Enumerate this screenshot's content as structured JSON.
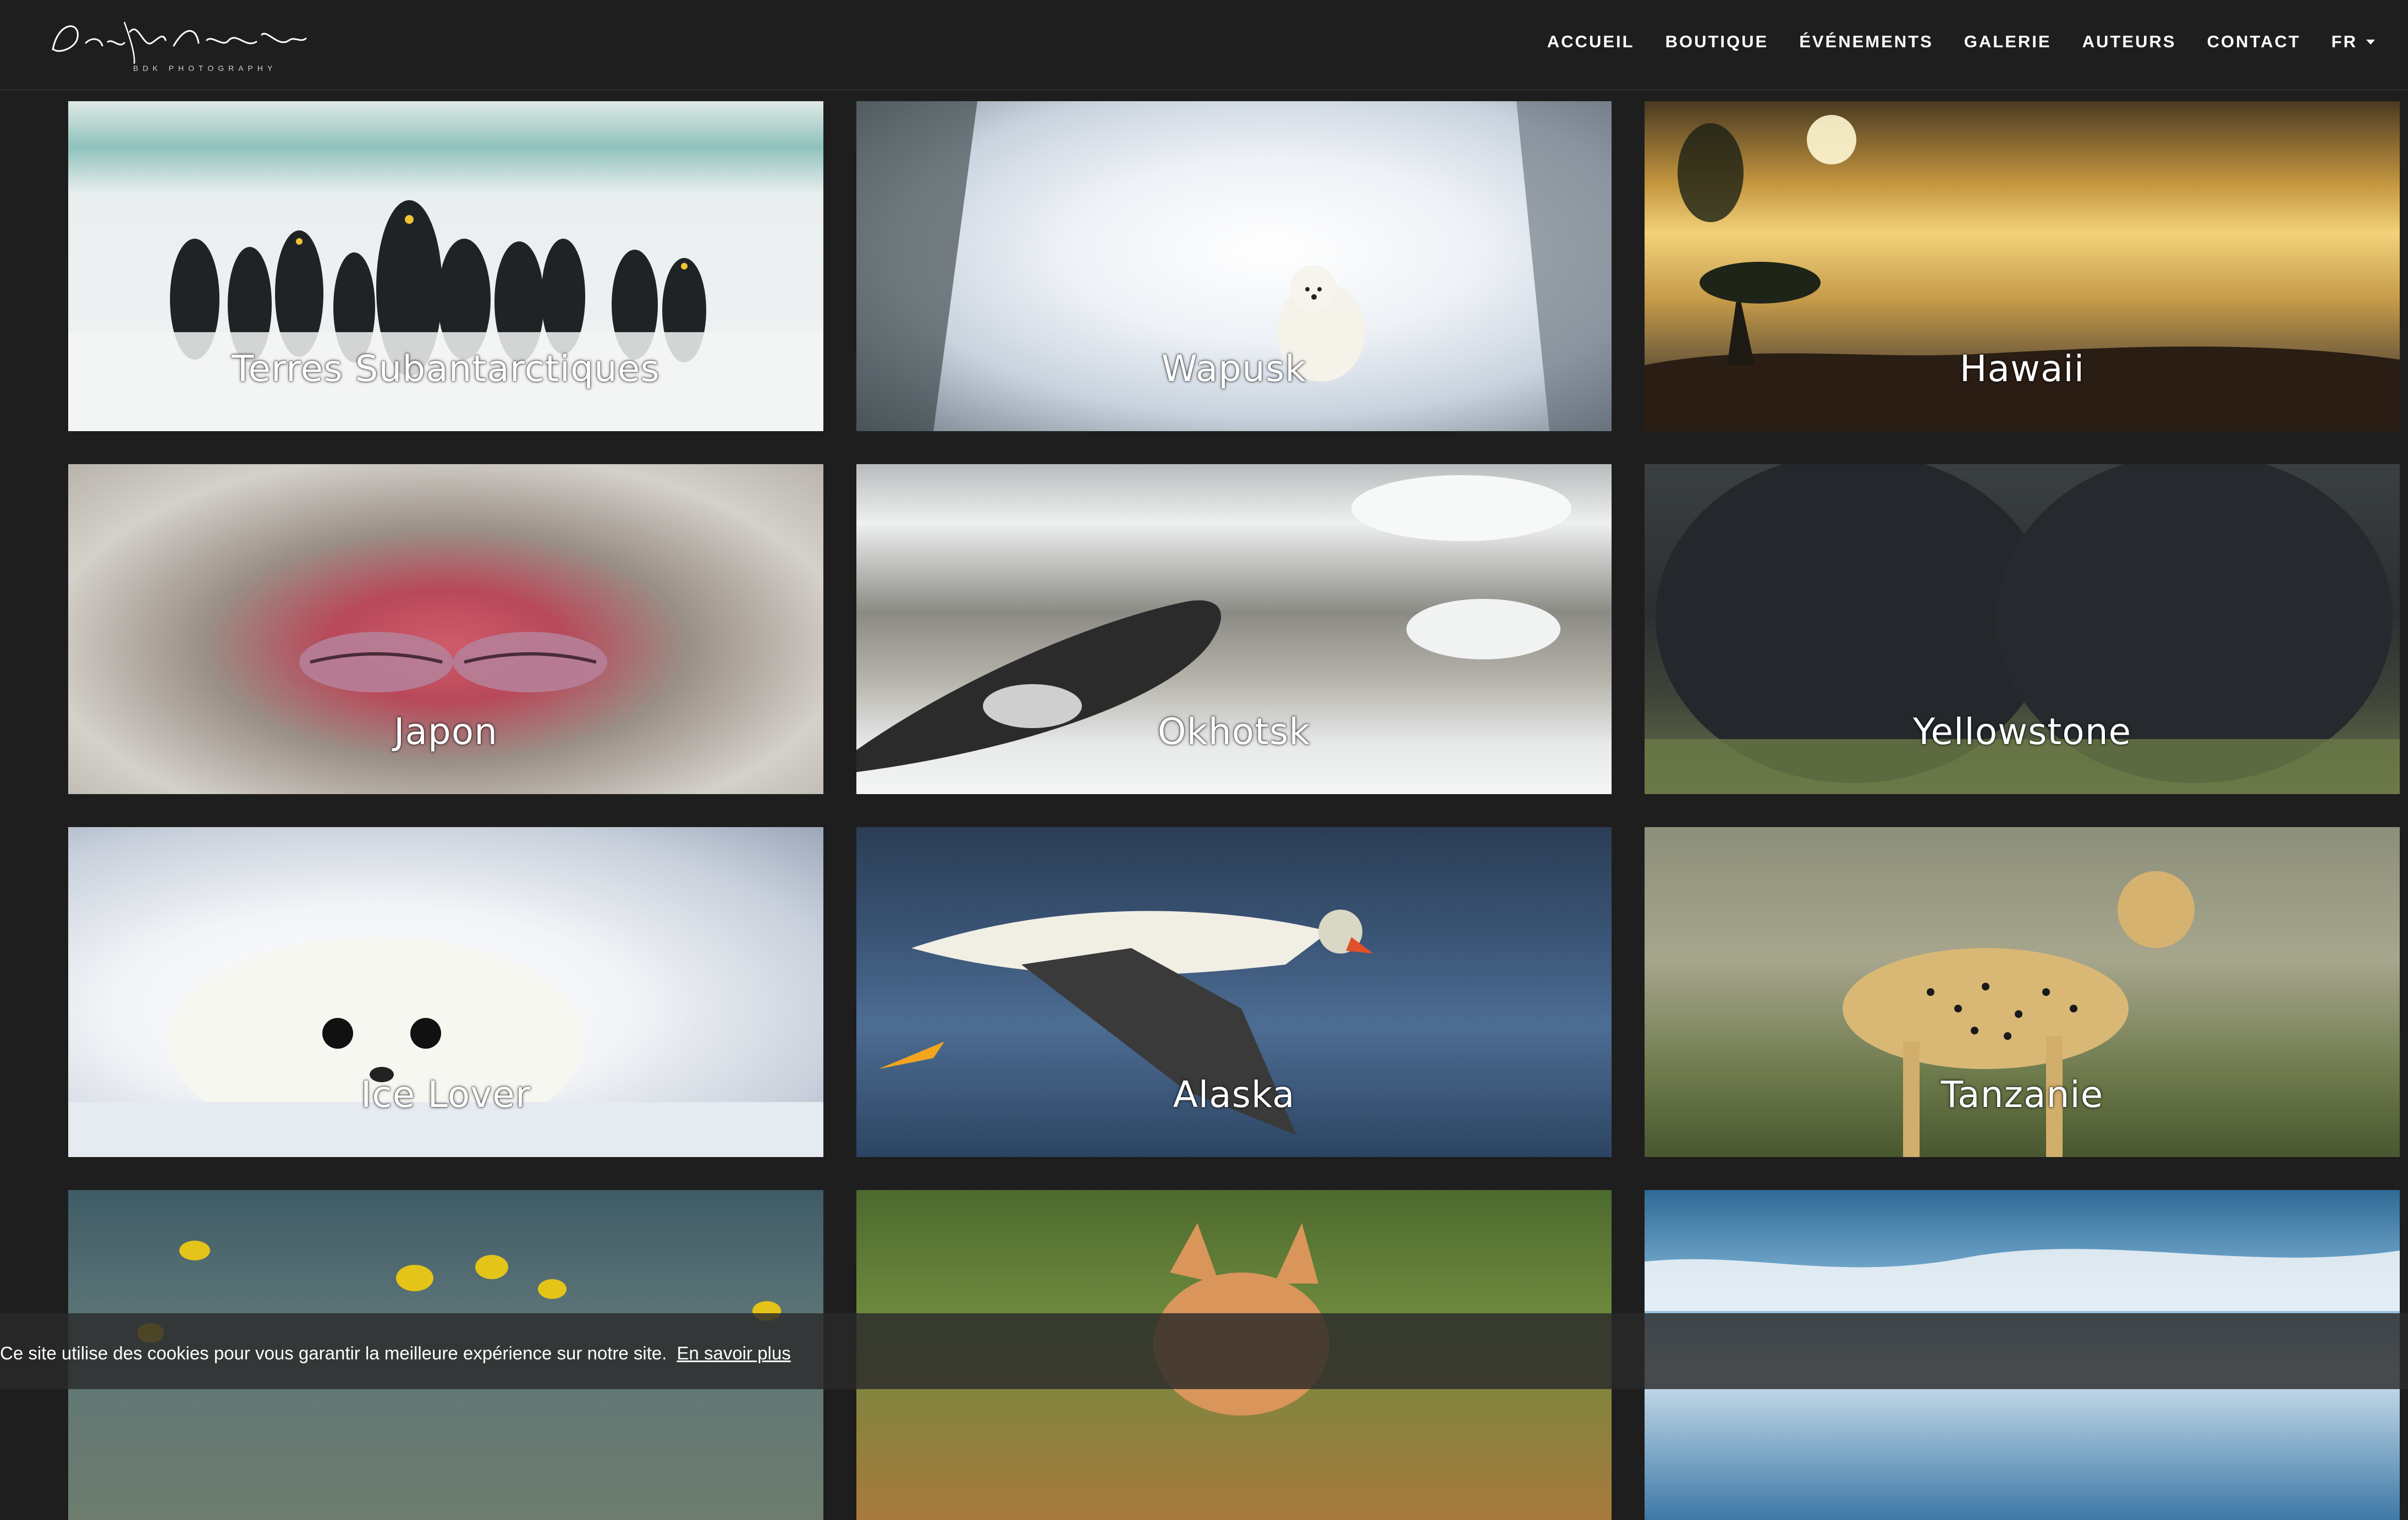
{
  "header": {
    "logo_text": "Dorota & Bruno Sénéchal",
    "logo_subtitle": "BDK PHOTOGRAPHY",
    "nav": [
      {
        "label": "ACCUEIL"
      },
      {
        "label": "BOUTIQUE"
      },
      {
        "label": "ÉVÉNEMENTS"
      },
      {
        "label": "GALERIE"
      },
      {
        "label": "AUTEURS"
      },
      {
        "label": "CONTACT"
      },
      {
        "label": "FR"
      }
    ]
  },
  "gallery": [
    {
      "label": "Terres Subantarctiques"
    },
    {
      "label": "Wapusk"
    },
    {
      "label": "Hawaii"
    },
    {
      "label": "Japon"
    },
    {
      "label": "Okhotsk"
    },
    {
      "label": "Yellowstone"
    },
    {
      "label": "Ice Lover"
    },
    {
      "label": "Alaska"
    },
    {
      "label": "Tanzanie"
    },
    {
      "label": ""
    },
    {
      "label": ""
    },
    {
      "label": ""
    }
  ],
  "cookie": {
    "text": "Ce site utilise des cookies pour vous garantir la meilleure expérience sur notre site.",
    "link": "En savoir plus"
  }
}
